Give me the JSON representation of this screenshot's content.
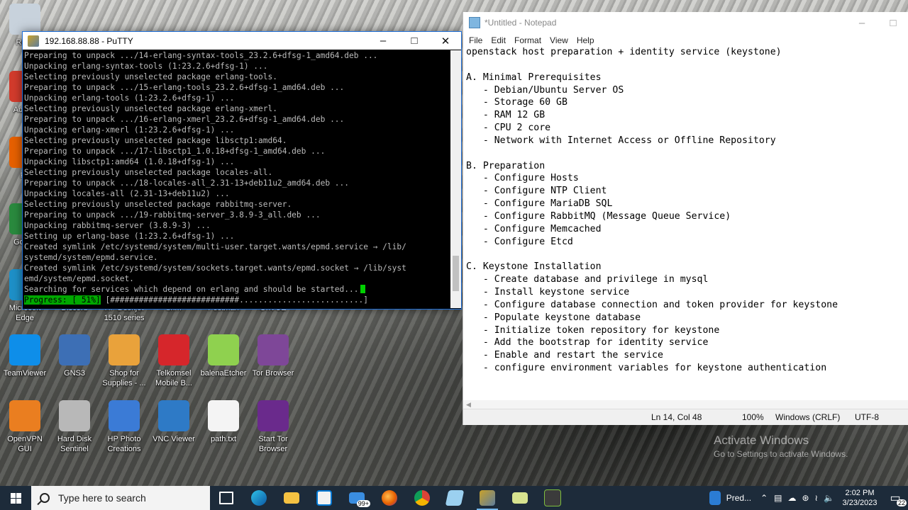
{
  "desktop": {
    "icons": [
      {
        "label": "Recy",
        "color": "#c8d2dc"
      },
      {
        "label": "Ad Acr",
        "color": "#d23b2c"
      },
      {
        "label": "Fir",
        "color": "#e66000"
      },
      {
        "label": "Go Ch",
        "color": "#2a8a3e"
      },
      {
        "label": "Microsoft Edge",
        "color": "#1e90c8"
      },
      {
        "label": "Discord",
        "color": "#5865f2"
      },
      {
        "label": "HP Deskjet 1510 series",
        "color": "#2d5b9a"
      },
      {
        "label": "bnm",
        "color": "#bbbbbb"
      },
      {
        "label": "Postman",
        "color": "#ef5b25"
      },
      {
        "label": "OnVUE",
        "color": "#3c3c3c"
      },
      {
        "label": "TeamViewer",
        "color": "#0e8ee9"
      },
      {
        "label": "GNS3",
        "color": "#3d6fb5"
      },
      {
        "label": "Shop for Supplies - ...",
        "color": "#e9a23b"
      },
      {
        "label": "Telkomsel Mobile B...",
        "color": "#d6262b"
      },
      {
        "label": "balenaEtcher",
        "color": "#8fd14f"
      },
      {
        "label": "Tor Browser",
        "color": "#7e4798"
      },
      {
        "label": "OpenVPN GUI",
        "color": "#ea7e20"
      },
      {
        "label": "Hard Disk Sentinel",
        "color": "#b8b8b8"
      },
      {
        "label": "HP Photo Creations",
        "color": "#3b7bd6"
      },
      {
        "label": "VNC Viewer",
        "color": "#2e7ac6"
      },
      {
        "label": "path.txt",
        "color": "#f4f4f4"
      },
      {
        "label": "Start Tor Browser",
        "color": "#6a2a8c"
      }
    ]
  },
  "putty": {
    "title": "192.168.88.88 - PuTTY",
    "lines": [
      "Preparing to unpack .../14-erlang-syntax-tools_23.2.6+dfsg-1_amd64.deb ...",
      "Unpacking erlang-syntax-tools (1:23.2.6+dfsg-1) ...",
      "Selecting previously unselected package erlang-tools.",
      "Preparing to unpack .../15-erlang-tools_23.2.6+dfsg-1_amd64.deb ...",
      "Unpacking erlang-tools (1:23.2.6+dfsg-1) ...",
      "Selecting previously unselected package erlang-xmerl.",
      "Preparing to unpack .../16-erlang-xmerl_23.2.6+dfsg-1_amd64.deb ...",
      "Unpacking erlang-xmerl (1:23.2.6+dfsg-1) ...",
      "Selecting previously unselected package libsctp1:amd64.",
      "Preparing to unpack .../17-libsctp1_1.0.18+dfsg-1_amd64.deb ...",
      "Unpacking libsctp1:amd64 (1.0.18+dfsg-1) ...",
      "Selecting previously unselected package locales-all.",
      "Preparing to unpack .../18-locales-all_2.31-13+deb11u2_amd64.deb ...",
      "Unpacking locales-all (2.31-13+deb11u2) ...",
      "Selecting previously unselected package rabbitmq-server.",
      "Preparing to unpack .../19-rabbitmq-server_3.8.9-3_all.deb ...",
      "Unpacking rabbitmq-server (3.8.9-3) ...",
      "Setting up erlang-base (1:23.2.6+dfsg-1) ...",
      "Created symlink /etc/systemd/system/multi-user.target.wants/epmd.service → /lib/",
      "systemd/system/epmd.service.",
      "Created symlink /etc/systemd/system/sockets.target.wants/epmd.socket → /lib/syst",
      "emd/system/epmd.socket.",
      "Searching for services which depend on erlang and should be started..."
    ],
    "progress_label": "Progress: [ 51%]",
    "progress_bar": "[###########################..........................]",
    "progress_fraction": 0.51
  },
  "notepad": {
    "title": "*Untitled - Notepad",
    "menu": [
      "File",
      "Edit",
      "Format",
      "View",
      "Help"
    ],
    "lines": [
      "openstack host preparation + identity service (keystone)",
      "",
      "A. Minimal Prerequisites",
      "   - Debian/Ubuntu Server OS",
      "   - Storage 60 GB",
      "   - RAM 12 GB",
      "   - CPU 2 core",
      "   - Network with Internet Access or Offline Repository",
      "",
      "B. Preparation",
      "   - Configure Hosts",
      "   - Configure NTP Client",
      "   - Configure MariaDB SQL",
      "   - Configure RabbitMQ (Message Queue Service)",
      "   - Configure Memcached",
      "   - Configure Etcd",
      "",
      "C. Keystone Installation",
      "   - Create database and privilege in mysql",
      "   - Install keystone service",
      "   - Configure database connection and token provider for keystone",
      "   - Populate keystone database",
      "   - Initialize token repository for keystone",
      "   - Add the bootstrap for identity service",
      "   - Enable and restart the service",
      "   - configure environment variables for keystone authentication"
    ],
    "status": {
      "position": "Ln 14, Col 48",
      "zoom": "100%",
      "line_ending": "Windows (CRLF)",
      "encoding": "UTF-8"
    }
  },
  "watermark": {
    "line1": "Activate Windows",
    "line2": "Go to Settings to activate Windows."
  },
  "taskbar": {
    "search_placeholder": "Type here to search",
    "mail_badge": "99+",
    "pinned_app_label": "Pred...",
    "time": "2:02 PM",
    "date": "3/23/2023",
    "notifications": "22",
    "accent": "#76b9ed"
  }
}
